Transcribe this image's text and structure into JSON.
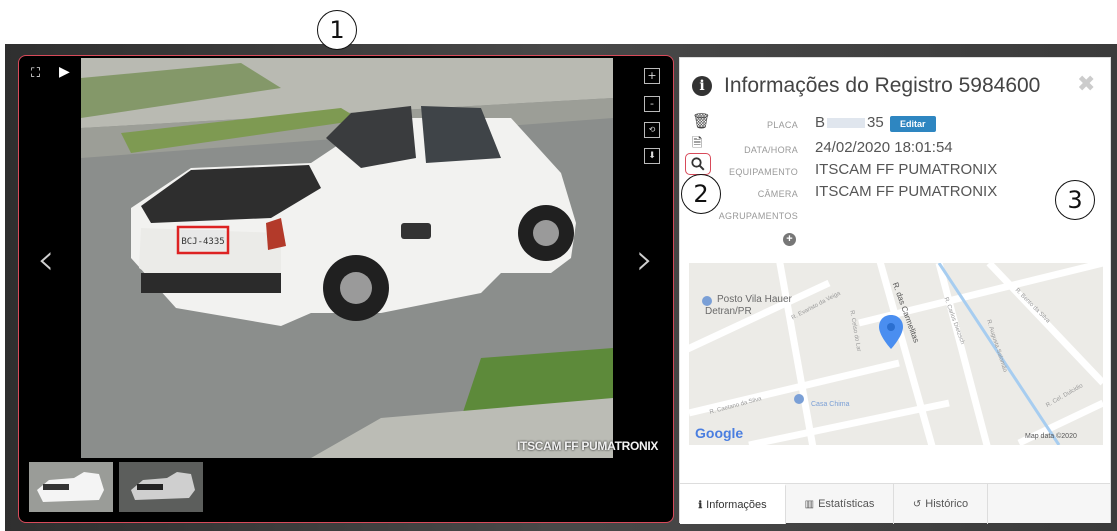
{
  "callouts": [
    "1",
    "2",
    "3"
  ],
  "viewer": {
    "watermark": "ITSCAM FF PUMATRONIX",
    "plate_text": "BCJ-4335",
    "icons": {
      "fullscreen": "expand-icon",
      "play": "play-icon",
      "zoom_in": "zoom-in-icon",
      "zoom_out": "zoom-out-icon",
      "rotate": "rotate-icon",
      "download": "download-icon",
      "prev": "chevron-left-icon",
      "next": "chevron-right-icon"
    },
    "zoom_in_label": "+",
    "zoom_out_label": "-",
    "thumbnails": [
      "thumbnail-1",
      "thumbnail-2"
    ]
  },
  "panel": {
    "title": "Informações do Registro 5984600",
    "fields": [
      {
        "label": "PLACA",
        "value": "B",
        "value_suffix": "35"
      },
      {
        "label": "DATA/HORA",
        "value": "24/02/2020 18:01:54"
      },
      {
        "label": "EQUIPAMENTO",
        "value": "ITSCAM FF PUMATRONIX"
      },
      {
        "label": "CÂMERA",
        "value": "ITSCAM FF PUMATRONIX"
      },
      {
        "label": "AGRUPAMENTOS",
        "value": ""
      }
    ],
    "edit_label": "Editar",
    "side_icons": [
      "trash-icon",
      "pdf-icon",
      "search-icon"
    ]
  },
  "map": {
    "place": "Posto Vila Hauer",
    "place_sub": "Detran/PR",
    "poi": "Casa Chima",
    "streets": [
      "R. Evaristo da Veiga",
      "R. das Carmelitas",
      "R. Carlos Dietzsch",
      "R. Celso do Lar",
      "R. Caetano da Silva",
      "R. Augusta Salomão",
      "R. Bento da Silva",
      "R. Cel. Dulcidio"
    ],
    "logo": "Google",
    "attribution": "Map data ©2020"
  },
  "tabs": [
    {
      "label": "Informações",
      "icon": "info-icon",
      "active": true
    },
    {
      "label": "Estatísticas",
      "icon": "bar-chart-icon",
      "active": false
    },
    {
      "label": "Histórico",
      "icon": "history-icon",
      "active": false
    }
  ],
  "colors": {
    "highlight": "#d84a5a",
    "edit_button": "#2e86c1",
    "map_pin": "#4a8ef0"
  }
}
